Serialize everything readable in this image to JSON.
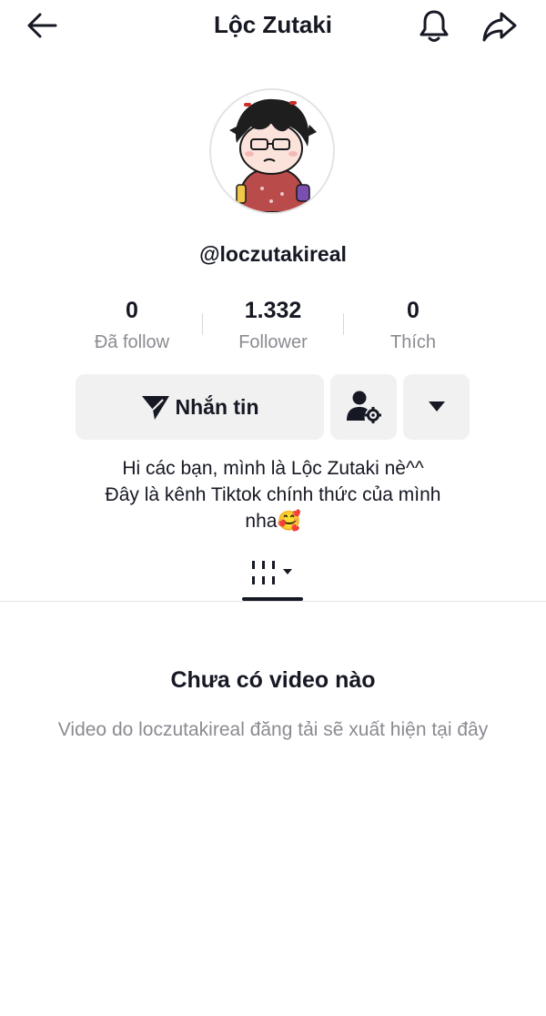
{
  "header": {
    "title": "Lộc Zutaki",
    "icons": [
      "arrow-left-icon",
      "bell-icon",
      "share-icon"
    ]
  },
  "profile": {
    "username": "@loczutakireal",
    "stats": [
      {
        "value": "0",
        "label": "Đã follow"
      },
      {
        "value": "1.332",
        "label": "Follower"
      },
      {
        "value": "0",
        "label": "Thích"
      }
    ]
  },
  "actions": {
    "message_label": "Nhắn tin"
  },
  "bio": {
    "line1": "Hi các bạn, mình là Lộc Zutaki nè^^",
    "line2": "Đây là kênh Tiktok chính thức của mình",
    "line3": "nha🥰"
  },
  "empty_state": {
    "title": "Chưa có video nào",
    "description": "Video do loczutakireal đăng tải sẽ xuất hiện tại đây"
  }
}
